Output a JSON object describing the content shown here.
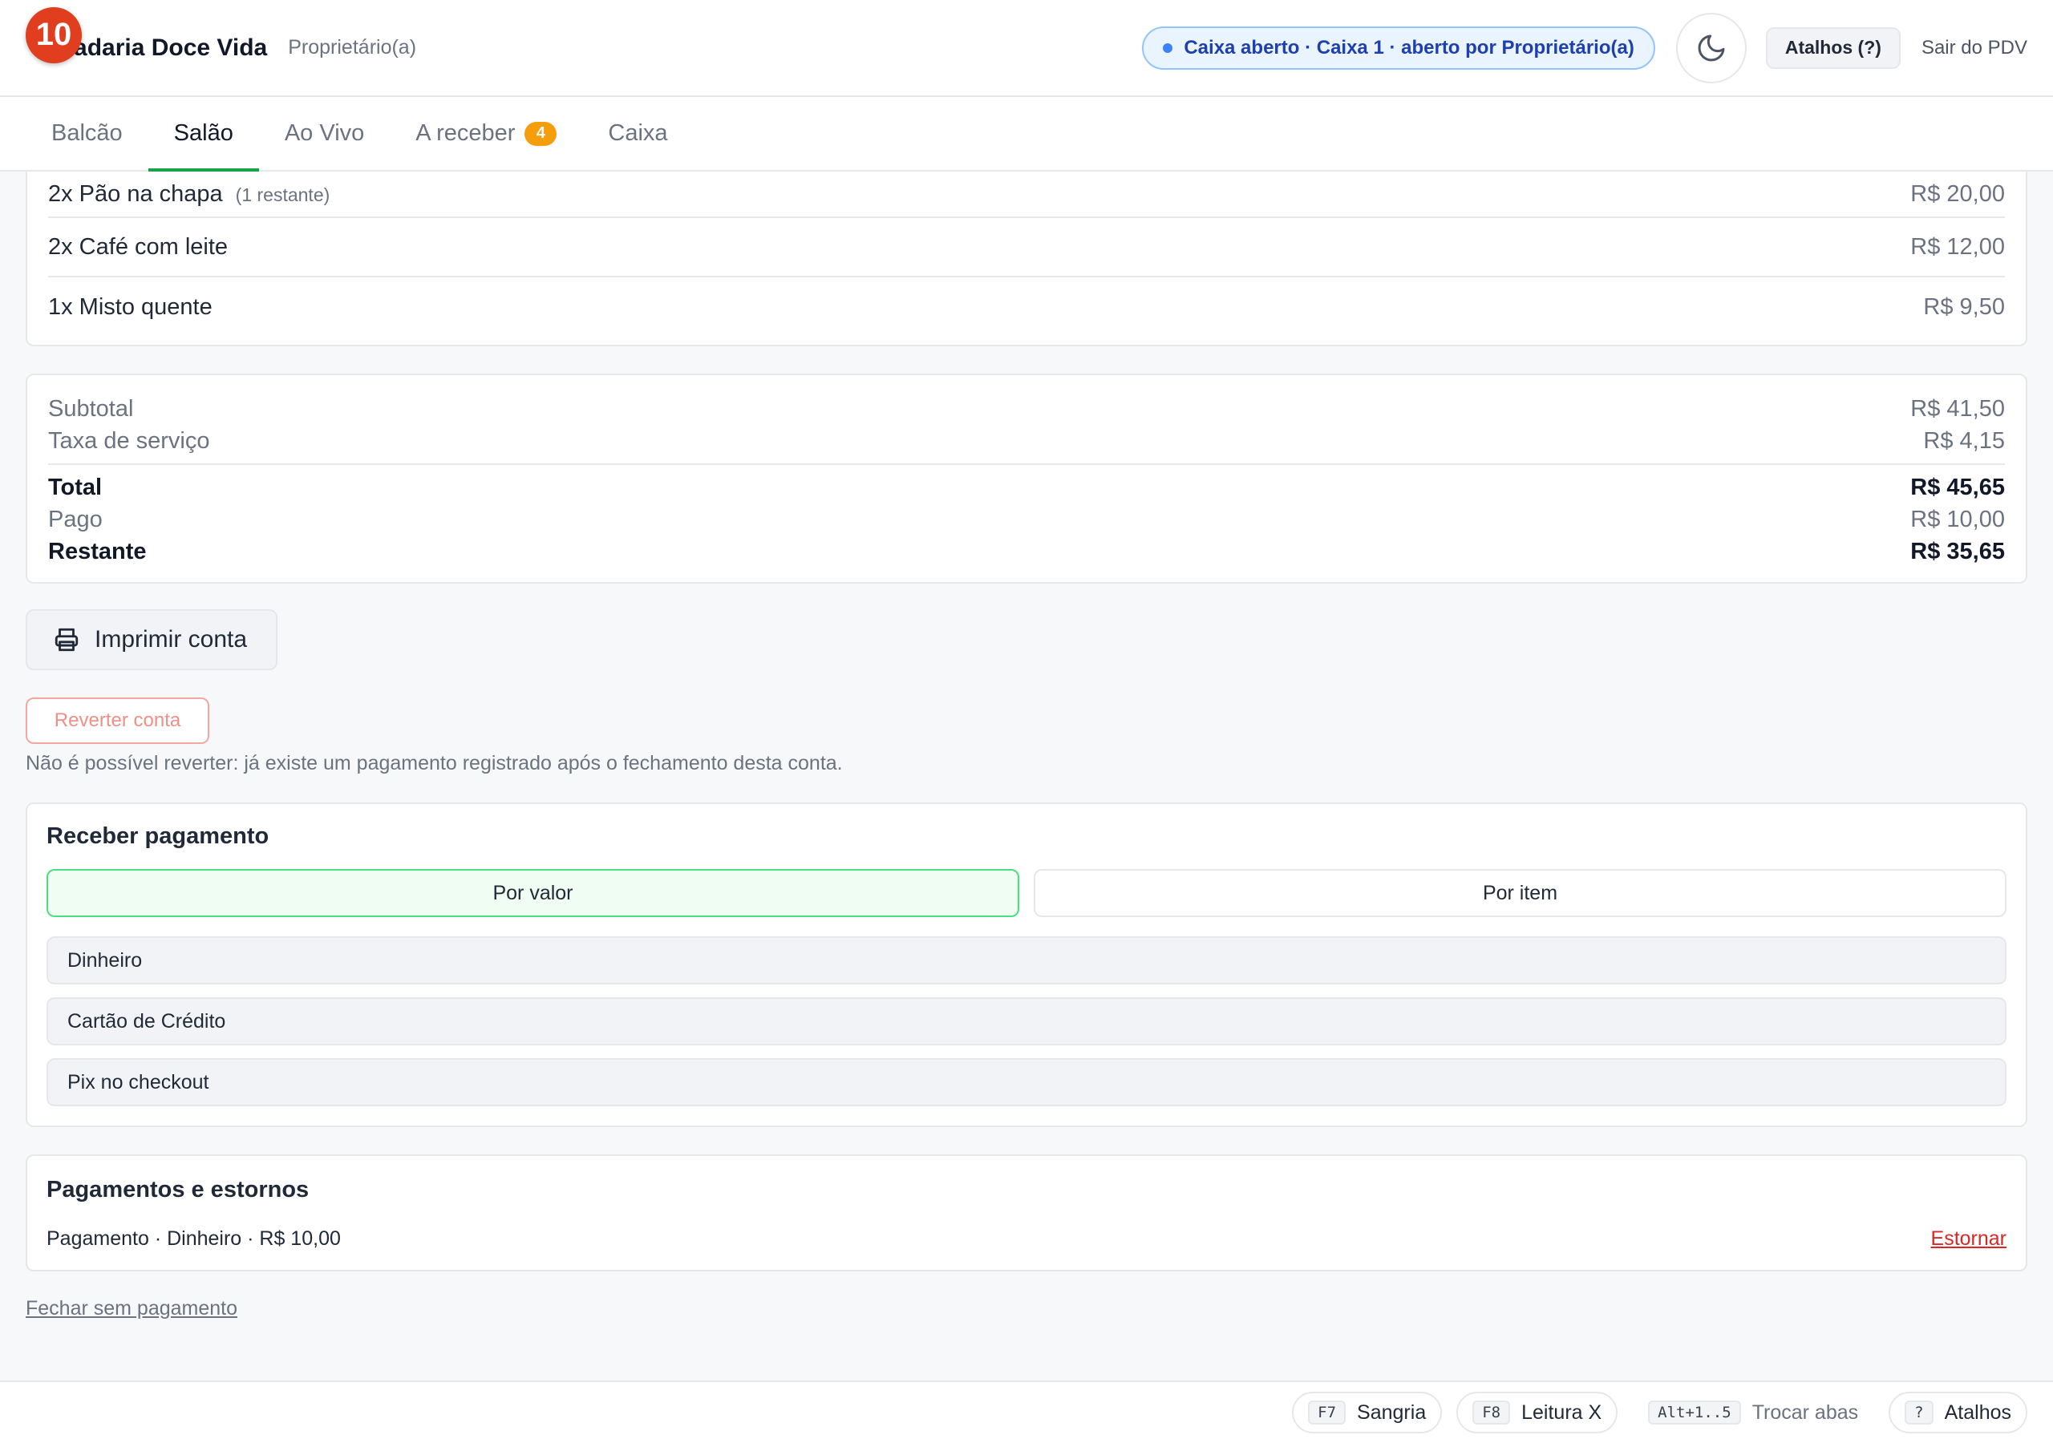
{
  "header": {
    "notification_count": "10",
    "brand_name": "Padaria Doce Vida",
    "role": "Proprietário(a)",
    "caixa_status": "Caixa aberto · Caixa 1 · aberto por Proprietário(a)",
    "shortcuts_button": "Atalhos (?)",
    "exit_link": "Sair do PDV"
  },
  "tabs": [
    {
      "label": "Balcão"
    },
    {
      "label": "Salão",
      "active": true
    },
    {
      "label": "Ao Vivo"
    },
    {
      "label": "A receber",
      "badge": "4"
    },
    {
      "label": "Caixa"
    }
  ],
  "items": [
    {
      "name": "2x Pão na chapa",
      "note": "(1 restante)",
      "price": "R$ 20,00"
    },
    {
      "name": "2x Café com leite",
      "note": "",
      "price": "R$ 12,00"
    },
    {
      "name": "1x Misto quente",
      "note": "",
      "price": "R$ 9,50"
    }
  ],
  "totals": {
    "subtotal_label": "Subtotal",
    "subtotal": "R$ 41,50",
    "service_label": "Taxa de serviço",
    "service": "R$ 4,15",
    "total_label": "Total",
    "total": "R$ 45,65",
    "paid_label": "Pago",
    "paid": "R$ 10,00",
    "remaining_label": "Restante",
    "remaining": "R$ 35,65"
  },
  "actions": {
    "print_label": "Imprimir conta",
    "revert_label": "Reverter conta",
    "revert_note": "Não é possível reverter: já existe um pagamento registrado após o fechamento desta conta.",
    "close_without_payment": "Fechar sem pagamento"
  },
  "payment": {
    "title": "Receber pagamento",
    "mode_by_value": "Por valor",
    "mode_by_item": "Por item",
    "methods": [
      "Dinheiro",
      "Cartão de Crédito",
      "Pix no checkout"
    ]
  },
  "history": {
    "title": "Pagamentos e estornos",
    "entries": [
      {
        "text": "Pagamento · Dinheiro · R$ 10,00",
        "action": "Estornar"
      }
    ]
  },
  "footer": {
    "shortcuts": [
      {
        "key": "F7",
        "label": "Sangria"
      },
      {
        "key": "F8",
        "label": "Leitura X"
      },
      {
        "key": "Alt+1..5",
        "label": "Trocar abas"
      },
      {
        "key": "?",
        "label": "Atalhos"
      }
    ]
  },
  "colors": {
    "accent": "#16a34a",
    "danger": "#dc2626",
    "badge": "#f59e0b",
    "notification": "#e03e1f",
    "info": "#1e40af"
  }
}
